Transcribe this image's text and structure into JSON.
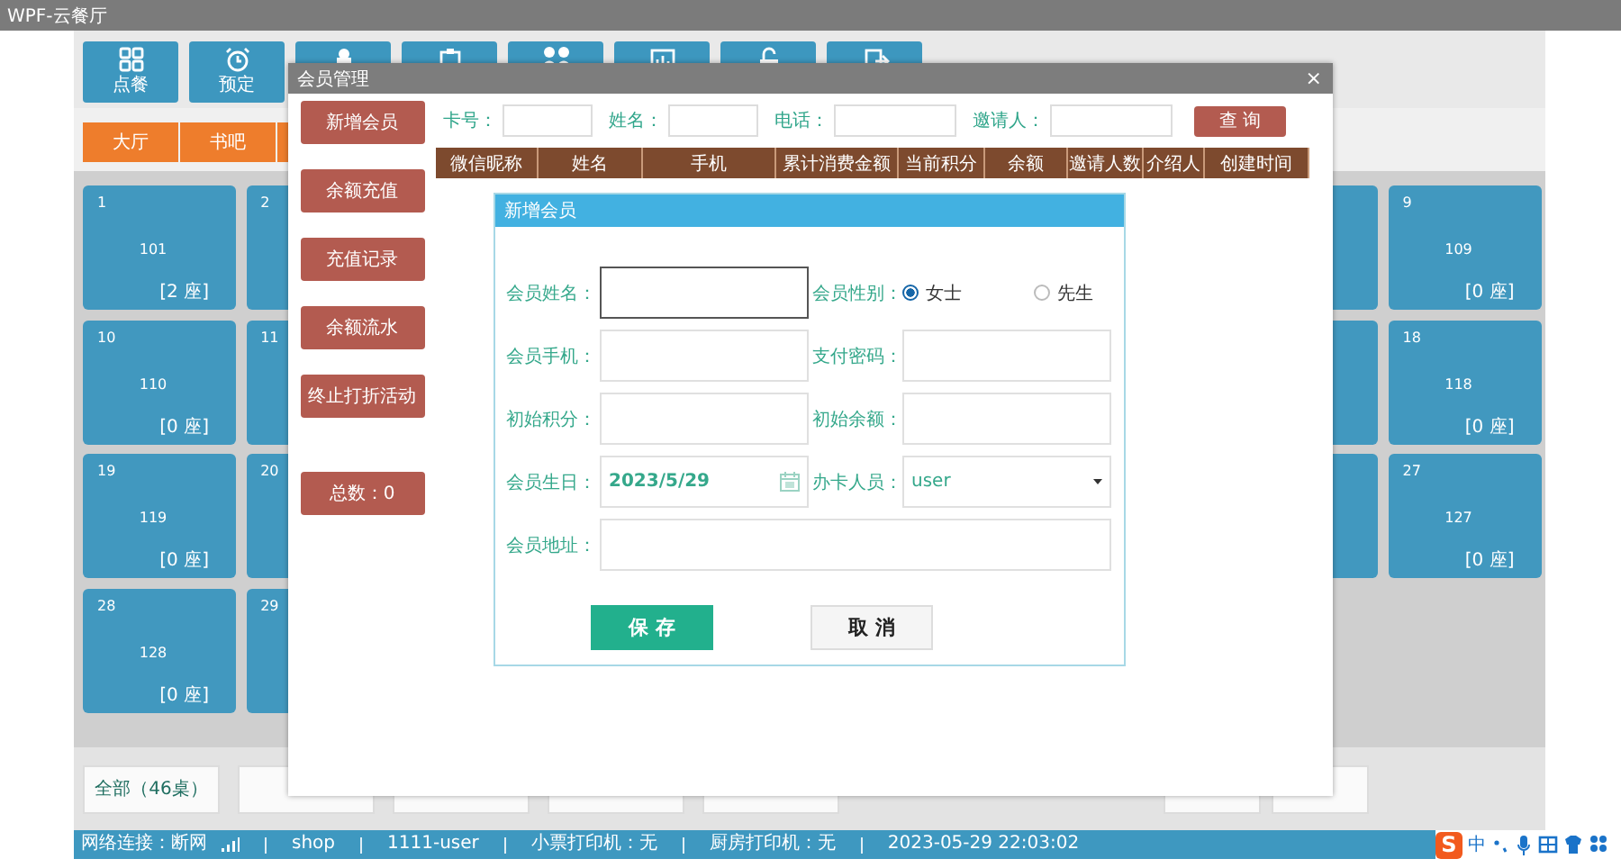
{
  "window": {
    "title": "WPF-云餐厅"
  },
  "nav_buttons": [
    {
      "kind": "tile",
      "label": "点餐"
    },
    {
      "kind": "tile",
      "label": "预定"
    },
    {
      "kind": "tile"
    },
    {
      "kind": "tile"
    },
    {
      "kind": "tile"
    },
    {
      "kind": "tile"
    },
    {
      "kind": "tile"
    },
    {
      "kind": "tile"
    }
  ],
  "areas": [
    {
      "kind": "tab",
      "label": "大厅"
    },
    {
      "kind": "tab",
      "label": "书吧"
    },
    {
      "kind": "tab"
    }
  ],
  "table_rows": [
    {
      "left": [
        {
          "kind": "table",
          "number": "1",
          "name": "101",
          "seats": "[2 座]"
        },
        {
          "kind": "table",
          "number": "2"
        }
      ],
      "right": [
        {
          "kind": "table"
        },
        {
          "kind": "table",
          "number": "9",
          "name": "109",
          "seats": "[0 座]"
        }
      ]
    },
    {
      "left": [
        {
          "kind": "table",
          "number": "10",
          "name": "110",
          "seats": "[0 座]"
        },
        {
          "kind": "table",
          "number": "11"
        }
      ],
      "right": [
        {
          "kind": "table"
        },
        {
          "kind": "table",
          "number": "18",
          "name": "118",
          "seats": "[0 座]"
        }
      ]
    },
    {
      "left": [
        {
          "kind": "table",
          "number": "19",
          "name": "119",
          "seats": "[0 座]"
        },
        {
          "kind": "table",
          "number": "20"
        }
      ],
      "right": [
        {
          "kind": "table"
        },
        {
          "kind": "table",
          "number": "27",
          "name": "127",
          "seats": "[0 座]"
        }
      ]
    },
    {
      "left": [
        {
          "kind": "table",
          "number": "28",
          "name": "128",
          "seats": "[0 座]"
        },
        {
          "kind": "table",
          "number": "29"
        }
      ]
    }
  ],
  "filters": [
    {
      "kind": "filter",
      "label": "全部（46桌）"
    },
    {
      "kind": "filter"
    },
    {
      "kind": "filter"
    },
    {
      "kind": "filter"
    },
    {
      "kind": "filter"
    }
  ],
  "pager": [
    {
      "kind": "page"
    },
    {
      "kind": "page"
    }
  ],
  "status_bar": {
    "network": "网络连接：断网",
    "items": [
      "shop",
      "1111-user",
      "小票打印机：无",
      "厨房打印机：无",
      "2023-05-29 22:03:02"
    ]
  },
  "tray": {
    "logo": "S",
    "ime_mode": "中"
  },
  "member_dialog": {
    "title": "会员管理",
    "close": "×",
    "actions": [
      "新增会员",
      "余额充值",
      "充值记录",
      "余额流水",
      "终止打折活动"
    ],
    "total": "总数：0",
    "search_labels": [
      "卡号：",
      "姓名：",
      "电话：",
      "邀请人："
    ],
    "search_button": "查 询",
    "columns": [
      "微信昵称",
      "姓名",
      "手机",
      "累计消费金额",
      "当前积分",
      "余额",
      "邀请人数",
      "介绍人",
      "创建时间"
    ]
  },
  "add_member_dialog": {
    "title": "新增会员",
    "fields": [
      {
        "kind": "text",
        "label": "会员姓名：",
        "focused": true
      },
      {
        "kind": "radio",
        "label": "会员性别：",
        "options": [
          {
            "label": "女士",
            "selected": true
          },
          {
            "label": "先生",
            "selected": false
          }
        ]
      },
      {
        "kind": "text",
        "label": "会员手机：",
        "focused": false
      },
      {
        "kind": "text",
        "label": "支付密码：",
        "focused": false
      },
      {
        "kind": "text",
        "label": "初始积分：",
        "focused": false
      },
      {
        "kind": "text",
        "label": "初始余额：",
        "focused": false
      },
      {
        "kind": "date",
        "label": "会员生日：",
        "value": "2023/5/29"
      },
      {
        "kind": "select",
        "label": "办卡人员：",
        "value": "user"
      },
      {
        "kind": "wide",
        "label": "会员地址：",
        "focused": false
      }
    ],
    "buttons": [
      {
        "kind": "primary",
        "label": "保 存"
      },
      {
        "kind": "secondary",
        "label": "取 消"
      }
    ]
  }
}
